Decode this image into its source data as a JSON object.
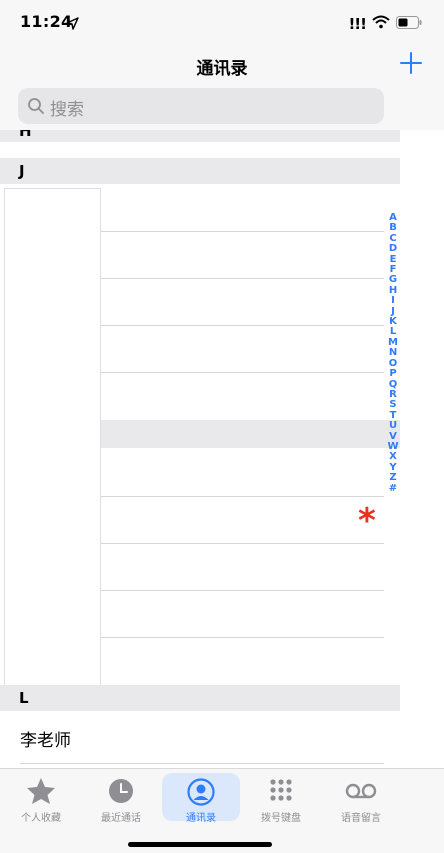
{
  "status": {
    "time": "11:24",
    "signal_text": "!!!"
  },
  "nav": {
    "title": "通讯录",
    "add_symbol": "+"
  },
  "search": {
    "placeholder": "搜索"
  },
  "sections": [
    {
      "letter": "H"
    },
    {
      "letter": "J"
    },
    {
      "letter": "L"
    }
  ],
  "contacts": [
    {
      "name": "李老师"
    }
  ],
  "index": [
    "A",
    "B",
    "C",
    "D",
    "E",
    "F",
    "G",
    "H",
    "I",
    "J",
    "K",
    "L",
    "M",
    "N",
    "O",
    "P",
    "Q",
    "R",
    "S",
    "T",
    "U",
    "V",
    "W",
    "X",
    "Y",
    "Z",
    "#"
  ],
  "asterisk": "*",
  "tabs": [
    {
      "label": "个人收藏",
      "icon": "star-icon",
      "active": false
    },
    {
      "label": "最近通话",
      "icon": "clock-icon",
      "active": false
    },
    {
      "label": "通讯录",
      "icon": "person-circle-icon",
      "active": true
    },
    {
      "label": "拨号键盘",
      "icon": "keypad-icon",
      "active": false
    },
    {
      "label": "语音留言",
      "icon": "voicemail-icon",
      "active": false
    }
  ],
  "colors": {
    "accent": "#2f7cf6",
    "asterisk": "#e8321e",
    "inactive": "#8e8e93"
  }
}
